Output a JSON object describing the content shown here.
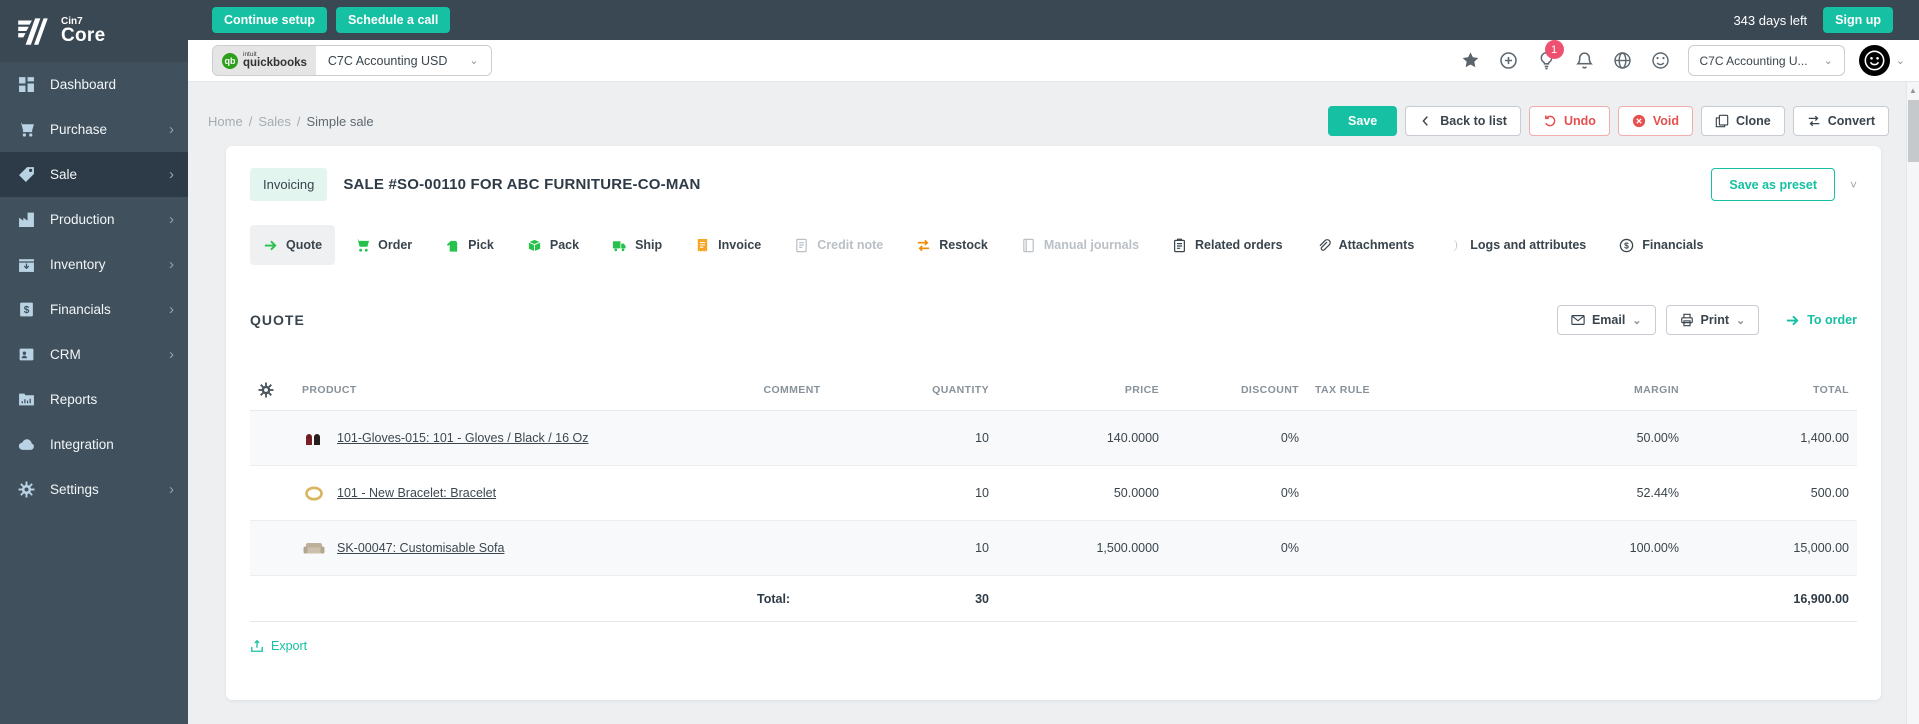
{
  "colors": {
    "accent": "#16c0a2",
    "danger": "#e6504f",
    "notification_badge": "#ee5170",
    "sidebar_bg": "#40505c",
    "topbar_bg": "#3a4854",
    "status_badge_bg": "#e3f5ef"
  },
  "brand": {
    "company": "Cin7",
    "product": "Core"
  },
  "topbar": {
    "continue_setup": "Continue setup",
    "schedule_call": "Schedule a call",
    "days_left": "343 days left",
    "sign_up": "Sign up"
  },
  "connector": {
    "qb_mark": "qb",
    "qb_intuit": "intuit",
    "qb_name": "quickbooks",
    "selected": "C7C Accounting USD"
  },
  "userbar": {
    "icons": [
      "star-icon",
      "add-circle-icon",
      "lightbulb-icon",
      "bell-icon",
      "globe-icon",
      "palette-icon"
    ],
    "notification_count": "1",
    "org_selected": "C7C Accounting U..."
  },
  "sidebar": {
    "items": [
      {
        "label": "Dashboard",
        "icon": "dashboard-icon",
        "active": false,
        "has_submenu": false
      },
      {
        "label": "Purchase",
        "icon": "purchase-icon",
        "active": false,
        "has_submenu": true
      },
      {
        "label": "Sale",
        "icon": "sale-tag-icon",
        "active": true,
        "has_submenu": true
      },
      {
        "label": "Production",
        "icon": "production-icon",
        "active": false,
        "has_submenu": true
      },
      {
        "label": "Inventory",
        "icon": "inventory-icon",
        "active": false,
        "has_submenu": true
      },
      {
        "label": "Financials",
        "icon": "financials-icon",
        "active": false,
        "has_submenu": true
      },
      {
        "label": "CRM",
        "icon": "crm-icon",
        "active": false,
        "has_submenu": true
      },
      {
        "label": "Reports",
        "icon": "reports-icon",
        "active": false,
        "has_submenu": false
      },
      {
        "label": "Integration",
        "icon": "integration-icon",
        "active": false,
        "has_submenu": false
      },
      {
        "label": "Settings",
        "icon": "settings-icon",
        "active": false,
        "has_submenu": true
      }
    ]
  },
  "breadcrumb": {
    "home": "Home",
    "section": "Sales",
    "current": "Simple sale"
  },
  "actions": {
    "save": "Save",
    "back": "Back to list",
    "undo": "Undo",
    "void": "Void",
    "clone": "Clone",
    "convert": "Convert"
  },
  "sale": {
    "status": "Invoicing",
    "title": "SALE #SO-00110 FOR ABC FURNITURE-CO-MAN",
    "save_as_preset": "Save as preset"
  },
  "tabs": [
    {
      "label": "Quote",
      "icon": "arrow-right-icon",
      "state": "active"
    },
    {
      "label": "Order",
      "icon": "cart-icon",
      "state": "normal"
    },
    {
      "label": "Pick",
      "icon": "pick-hand-icon",
      "state": "normal"
    },
    {
      "label": "Pack",
      "icon": "pack-box-icon",
      "state": "normal"
    },
    {
      "label": "Ship",
      "icon": "truck-icon",
      "state": "normal"
    },
    {
      "label": "Invoice",
      "icon": "receipt-icon",
      "state": "normal"
    },
    {
      "label": "Credit note",
      "icon": "document-icon",
      "state": "disabled"
    },
    {
      "label": "Restock",
      "icon": "swap-arrows-icon",
      "state": "normal"
    },
    {
      "label": "Manual journals",
      "icon": "journal-icon",
      "state": "disabled"
    },
    {
      "label": "Related orders",
      "icon": "clipboard-icon",
      "state": "normal"
    },
    {
      "label": "Attachments",
      "icon": "paperclip-icon",
      "state": "normal"
    },
    {
      "label": "Logs and attributes",
      "icon": "crescent-icon",
      "state": "normal"
    },
    {
      "label": "Financials",
      "icon": "dollar-circle-icon",
      "state": "normal"
    }
  ],
  "quote": {
    "heading": "QUOTE",
    "email": "Email",
    "print": "Print",
    "to_order": "To order",
    "export": "Export"
  },
  "table": {
    "columns": [
      "PRODUCT",
      "COMMENT",
      "QUANTITY",
      "PRICE",
      "DISCOUNT",
      "TAX RULE",
      "MARGIN",
      "TOTAL"
    ],
    "rows": [
      {
        "thumb": "gloves-thumbnail",
        "product": "101-Gloves-015: 101 - Gloves / Black / 16 Oz",
        "comment": "",
        "quantity": "10",
        "price": "140.0000",
        "discount": "0%",
        "tax_rule": "",
        "margin": "50.00%",
        "total": "1,400.00"
      },
      {
        "thumb": "bracelet-thumbnail",
        "product": "101 - New Bracelet: Bracelet",
        "comment": "",
        "quantity": "10",
        "price": "50.0000",
        "discount": "0%",
        "tax_rule": "",
        "margin": "52.44%",
        "total": "500.00"
      },
      {
        "thumb": "sofa-thumbnail",
        "product": "SK-00047: Customisable Sofa",
        "comment": "",
        "quantity": "10",
        "price": "1,500.0000",
        "discount": "0%",
        "tax_rule": "",
        "margin": "100.00%",
        "total": "15,000.00"
      }
    ],
    "total": {
      "label": "Total:",
      "quantity": "30",
      "amount": "16,900.00"
    }
  }
}
